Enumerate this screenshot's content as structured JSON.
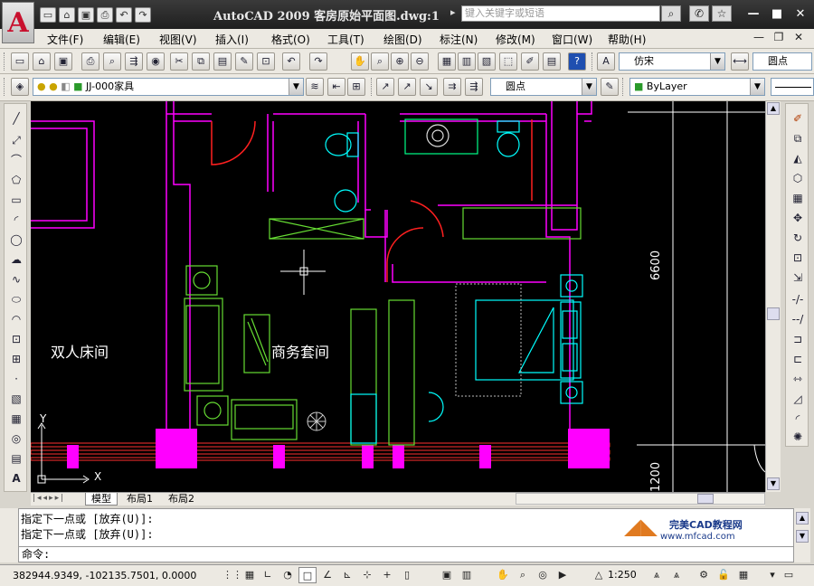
{
  "app": {
    "title": "AutoCAD  2009  客房原始平面图.dwg:1",
    "logo_letter": "A",
    "search_placeholder": "键入关键字或短语"
  },
  "menu": [
    "文件(F)",
    "编辑(E)",
    "视图(V)",
    "插入(I)",
    "格式(O)",
    "工具(T)",
    "绘图(D)",
    "标注(N)",
    "修改(M)",
    "窗口(W)",
    "帮助(H)"
  ],
  "toolbar": {
    "text_style": "仿宋",
    "dim_style": "圆点",
    "layer": "JJ-000家具",
    "mleader_style": "圆点",
    "color": "ByLayer"
  },
  "drawing": {
    "room_labels": [
      "双人床间",
      "商务套间"
    ],
    "dimensions": [
      "6600",
      "1200"
    ],
    "ucs_x": "X",
    "ucs_y": "Y"
  },
  "tabs": [
    "模型",
    "布局1",
    "布局2"
  ],
  "command": {
    "history": [
      "指定下一点或 [放弃(U)]:",
      "指定下一点或 [放弃(U)]:"
    ],
    "prompt": "命令:"
  },
  "watermark": {
    "name": "完美CAD教程网",
    "url": "www.mfcad.com"
  },
  "status": {
    "coords": "382944.9349, -102135.7501, 0.0000",
    "scale": "1:250"
  },
  "colors": {
    "wall": "#ff00ff",
    "furniture": "#00ffff",
    "green": "#66dd33",
    "door": "#ff2020",
    "canvas_bg": "#000000"
  }
}
